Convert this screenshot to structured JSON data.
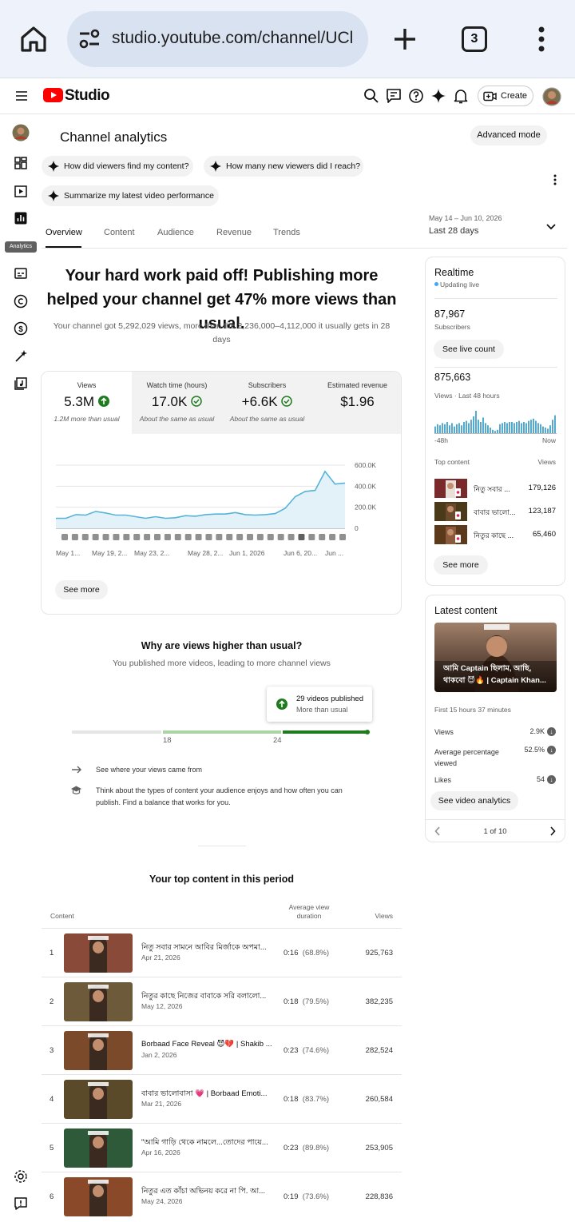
{
  "browser": {
    "url": "studio.youtube.com/channel/UCl",
    "tab_count": "3"
  },
  "header": {
    "brand": "Studio",
    "create_label": "Create"
  },
  "sidebar": {
    "active_tooltip": "Analytics"
  },
  "page": {
    "title": "Channel analytics",
    "advanced_mode": "Advanced mode",
    "ask_chips": [
      "How did viewers find my content?",
      "How many new viewers did I reach?",
      "Summarize my latest video performance"
    ],
    "date_range_dates": "May 14 – Jun 10, 2026",
    "date_range_label": "Last 28 days",
    "tabs": [
      "Overview",
      "Content",
      "Audience",
      "Revenue",
      "Trends"
    ],
    "active_tab": "Overview"
  },
  "overview": {
    "headline": "Your hard work paid off! Publishing more helped your channel get 47% more views than usual.",
    "subheadline": "Your channel got 5,292,029 views, more than the 3,236,000–4,112,000 it usually gets in 28 days",
    "kpis": [
      {
        "label": "Views",
        "value": "5.3M",
        "note": "1.2M more than usual",
        "status": "up"
      },
      {
        "label": "Watch time (hours)",
        "value": "17.0K",
        "note": "About the same as usual",
        "status": "ok"
      },
      {
        "label": "Subscribers",
        "value": "+6.6K",
        "note": "About the same as usual",
        "status": "ok"
      },
      {
        "label": "Estimated revenue",
        "value": "$1.96",
        "note": "",
        "status": "none"
      }
    ],
    "see_more": "See more"
  },
  "chart_data": {
    "type": "area",
    "series": [
      {
        "values": [
          95,
          95,
          130,
          125,
          160,
          145,
          125,
          125,
          110,
          95,
          110,
          95,
          100,
          120,
          115,
          130,
          135,
          135,
          150,
          130,
          125,
          130,
          140,
          190,
          300,
          350,
          360,
          540,
          420,
          430
        ]
      }
    ],
    "x_tick_labels": [
      "May 1...",
      "May 19, 2...",
      "May 23, 2...",
      "May 28, 2...",
      "Jun 1, 2026",
      "Jun 6, 20...",
      "Jun ..."
    ],
    "y_tick_labels": [
      "600.0K",
      "400.0K",
      "200.0K",
      "0"
    ],
    "ylim": [
      0,
      600000
    ],
    "grid": true,
    "video_markers": 28
  },
  "why": {
    "title": "Why are views higher than usual?",
    "subtitle": "You published more videos, leading to more channel views",
    "tooltip_title": "29 videos published",
    "tooltip_sub": "More than usual",
    "ticks": [
      "18",
      "24"
    ],
    "tip1": "See where your views came from",
    "tip2": "Think about the types of content your audience enjoys and how often you can publish. Find a balance that works for you."
  },
  "top_content": {
    "title": "Your top content in this period",
    "col_content": "Content",
    "col_avd": "Average view duration",
    "col_views": "Views",
    "rows": [
      {
        "idx": "1",
        "title": "নিতু সবার সামনে আবির মির্জাকে অপমা...",
        "date": "Apr 21, 2026",
        "avd": "0:16",
        "pct": "(68.8%)",
        "views": "925,763",
        "bg": "#8a4a3a"
      },
      {
        "idx": "2",
        "title": "নিতুর কাছে নিজের বাবাকে সরি বলালো...",
        "date": "May 12, 2026",
        "avd": "0:18",
        "pct": "(79.5%)",
        "views": "382,235",
        "bg": "#6d5a3a"
      },
      {
        "idx": "3",
        "title": "Borbaad Face Reveal 😈💔 | Shakib ...",
        "date": "Jan 2, 2026",
        "avd": "0:23",
        "pct": "(74.6%)",
        "views": "282,524",
        "bg": "#7a4a2a"
      },
      {
        "idx": "4",
        "title": "বাবার ভালোবাসা 💗 | Borbaad Emoti...",
        "date": "Mar 21, 2026",
        "avd": "0:18",
        "pct": "(83.7%)",
        "views": "260,584",
        "bg": "#5a4a2a"
      },
      {
        "idx": "5",
        "title": "\"আমি গাড়ি থেকে নামলে...তোদের পায়ে...",
        "date": "Apr 16, 2026",
        "avd": "0:23",
        "pct": "(89.8%)",
        "views": "253,905",
        "bg": "#2f5a3a"
      },
      {
        "idx": "6",
        "title": "নিতুর এত কাঁচা অভিনয় করে না পি. আ...",
        "date": "May 24, 2026",
        "avd": "0:19",
        "pct": "(73.6%)",
        "views": "228,836",
        "bg": "#8a4a2a"
      }
    ]
  },
  "realtime": {
    "title": "Realtime",
    "status": "Updating live",
    "subs_value": "87,967",
    "subs_label": "Subscribers",
    "see_live": "See live count",
    "views_value": "875,663",
    "views_label": "Views · Last 48 hours",
    "axis_left": "-48h",
    "axis_right": "Now",
    "bars": [
      6,
      8,
      7,
      9,
      8,
      10,
      7,
      9,
      6,
      8,
      9,
      7,
      10,
      11,
      9,
      12,
      15,
      20,
      12,
      10,
      14,
      9,
      7,
      5,
      3,
      2,
      3,
      8,
      9,
      10,
      9,
      10,
      10,
      9,
      10,
      11,
      9,
      10,
      9,
      11,
      12,
      13,
      11,
      9,
      8,
      6,
      5,
      4,
      7,
      12,
      16
    ],
    "top_content_label": "Top content",
    "top_views_label": "Views",
    "top": [
      {
        "title": "নিতু সবার ...",
        "views": "179,126"
      },
      {
        "title": "বাবার ভালো...",
        "views": "123,187"
      },
      {
        "title": "নিতুর কাছে ...",
        "views": "65,460"
      }
    ],
    "see_more": "See more"
  },
  "latest": {
    "title": "Latest content",
    "thumb_caption": "আমি Captain ছিলাম, আছি, থাকবো 😈🔥 | Captain Khan...",
    "period": "First 15 hours 37 minutes",
    "stats": [
      {
        "label": "Views",
        "value": "2.9K"
      },
      {
        "label": "Average percentage viewed",
        "value": "52.5%"
      },
      {
        "label": "Likes",
        "value": "54"
      }
    ],
    "cta": "See video analytics",
    "pager": "1 of 10"
  }
}
